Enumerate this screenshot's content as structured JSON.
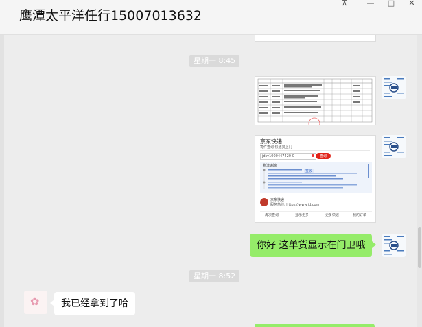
{
  "window": {
    "title": "鹰潭太平洋任行15007013632",
    "controls": {
      "pin": "⊼",
      "minimize": "—",
      "maximize": "□",
      "close": "✕"
    }
  },
  "messages": {
    "time1": "星期一 8:45",
    "time2": "星期一 8:52",
    "sent_text": "你好   这单货显示在门卫哦",
    "received_text": "我已经拿到了哈"
  },
  "screenshot2": {
    "header": "京东快递",
    "tabs": "寄件查询   快递员上门",
    "input_value": "jdsv1000447420-0",
    "search_button": "查询",
    "section": "物流追踪",
    "badge": "签收",
    "courier": "京东快递",
    "phone": "服务热线: https://www.jd.com",
    "tab_buttons": [
      "再次查询",
      "显示更多",
      "更多快递",
      "我的订单"
    ]
  },
  "avatar_emoji": "✿"
}
